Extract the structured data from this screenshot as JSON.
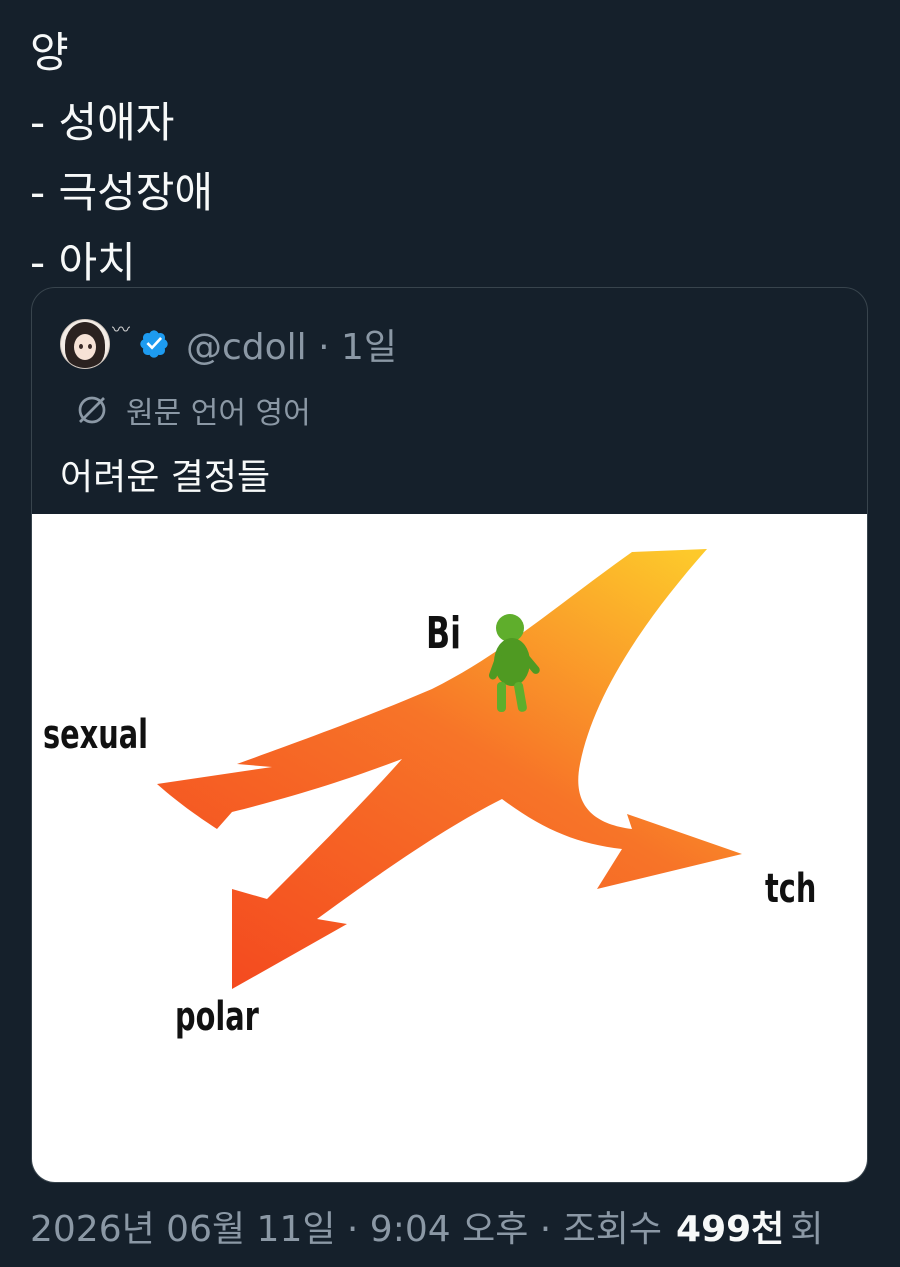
{
  "tweet": {
    "lines": [
      "양",
      "- 성애자",
      "- 극성장애",
      "- 아치"
    ]
  },
  "quote": {
    "handle": "@cdoll · 1일",
    "translate": "원문 언어 영어",
    "text": "어려운 결정들",
    "meme_labels": {
      "center": "Bi",
      "left": "sexual",
      "bottom": "polar",
      "right": "tch"
    }
  },
  "footer": {
    "meta": "2026년 06월 11일 · 9:04 오후 · 조회수",
    "views": "499천",
    "unit": "회"
  },
  "colors": {
    "background": "#15202b",
    "text": "#f7f9f9",
    "muted": "#8b98a5",
    "verified": "#1d9bf0",
    "border": "#38444d"
  }
}
